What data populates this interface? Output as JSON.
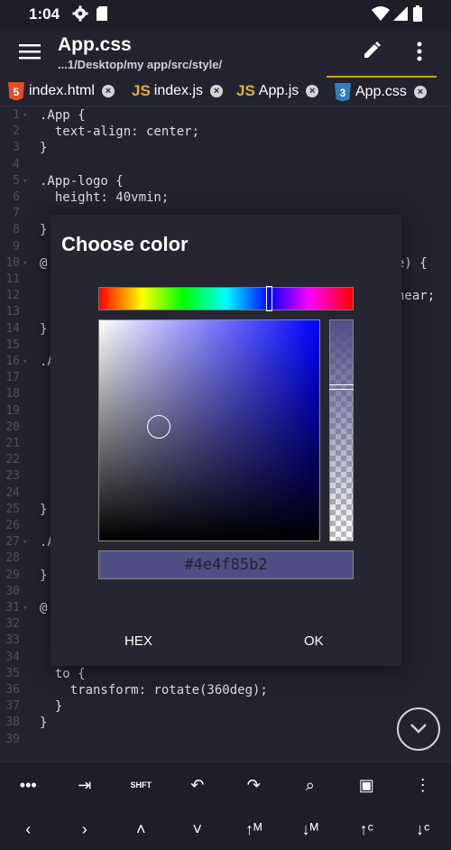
{
  "status_bar": {
    "time": "1:04"
  },
  "app_bar": {
    "title": "App.css",
    "subtitle": "...1/Desktop/my app/src/style/"
  },
  "tabs": [
    {
      "label": "index.html",
      "icon": "html5-icon"
    },
    {
      "label": "index.js",
      "icon": "js-icon"
    },
    {
      "label": "App.js",
      "icon": "js-icon"
    },
    {
      "label": "App.css",
      "icon": "css3-icon",
      "active": true
    }
  ],
  "editor": {
    "lines": [
      {
        "n": "1",
        "text": ".App {"
      },
      {
        "n": "2",
        "text": "  text-align: center;"
      },
      {
        "n": "3",
        "text": "}"
      },
      {
        "n": "4",
        "text": ""
      },
      {
        "n": "5",
        "text": ".App-logo {"
      },
      {
        "n": "6",
        "text": "  height: 40vmin;"
      },
      {
        "n": "7",
        "text": ""
      },
      {
        "n": "8",
        "text": "}"
      },
      {
        "n": "9",
        "text": ""
      },
      {
        "n": "10",
        "text": "@"
      },
      {
        "n": "11",
        "text": ""
      },
      {
        "n": "12",
        "text": ""
      },
      {
        "n": "13",
        "text": ""
      },
      {
        "n": "14",
        "text": "}"
      },
      {
        "n": "15",
        "text": ""
      },
      {
        "n": "16",
        "text": ".A"
      },
      {
        "n": "17",
        "text": ""
      },
      {
        "n": "18",
        "text": ""
      },
      {
        "n": "19",
        "text": ""
      },
      {
        "n": "20",
        "text": ""
      },
      {
        "n": "21",
        "text": ""
      },
      {
        "n": "22",
        "text": ""
      },
      {
        "n": "23",
        "text": ""
      },
      {
        "n": "24",
        "text": ""
      },
      {
        "n": "25",
        "text": "}"
      },
      {
        "n": "26",
        "text": ""
      },
      {
        "n": "27",
        "text": ".A"
      },
      {
        "n": "28",
        "text": ""
      },
      {
        "n": "29",
        "text": "}"
      },
      {
        "n": "30",
        "text": ""
      },
      {
        "n": "31",
        "text": "@"
      },
      {
        "n": "32",
        "text": ""
      },
      {
        "n": "33",
        "text": ""
      },
      {
        "n": "34",
        "text": ""
      },
      {
        "n": "35",
        "text": "  to {"
      },
      {
        "n": "36",
        "text": "    transform: rotate(360deg);"
      },
      {
        "n": "37",
        "text": "  }"
      },
      {
        "n": "38",
        "text": "}"
      },
      {
        "n": "39",
        "text": ""
      }
    ],
    "side_fragments": {
      "line10_right": "e) {",
      "line12_right": "near;"
    }
  },
  "dialog": {
    "title": "Choose color",
    "hex_value": "#4e4f85b2",
    "hex_button": "HEX",
    "ok_button": "OK",
    "hue": 240,
    "saturation": 0.27,
    "brightness": 0.52,
    "alpha": 0.7
  },
  "toolbar_row1": [
    {
      "name": "more-horiz-icon",
      "glyph": "•••"
    },
    {
      "name": "tab-indent-icon",
      "glyph": "⇥"
    },
    {
      "name": "shift-key-icon",
      "glyph": "SHFT"
    },
    {
      "name": "undo-icon",
      "glyph": "↶"
    },
    {
      "name": "redo-icon",
      "glyph": "↷"
    },
    {
      "name": "search-icon",
      "glyph": "⌕"
    },
    {
      "name": "save-icon",
      "glyph": "▣"
    },
    {
      "name": "more-vert-icon",
      "glyph": "⋮"
    }
  ],
  "toolbar_row2": [
    {
      "name": "cursor-left-icon",
      "glyph": "‹"
    },
    {
      "name": "cursor-right-icon",
      "glyph": "›"
    },
    {
      "name": "cursor-up-icon",
      "glyph": "˄"
    },
    {
      "name": "cursor-down-icon",
      "glyph": "˅"
    },
    {
      "name": "move-line-up-icon",
      "glyph": "↑ᴹ"
    },
    {
      "name": "move-line-down-icon",
      "glyph": "↓ᴹ"
    },
    {
      "name": "copy-line-up-icon",
      "glyph": "↑ᶜ"
    },
    {
      "name": "copy-line-down-icon",
      "glyph": "↓ᶜ"
    }
  ],
  "colors": {
    "background": "#23232f",
    "active_tab_accent": "#c9a227",
    "selected_color": "#4e4f85"
  }
}
